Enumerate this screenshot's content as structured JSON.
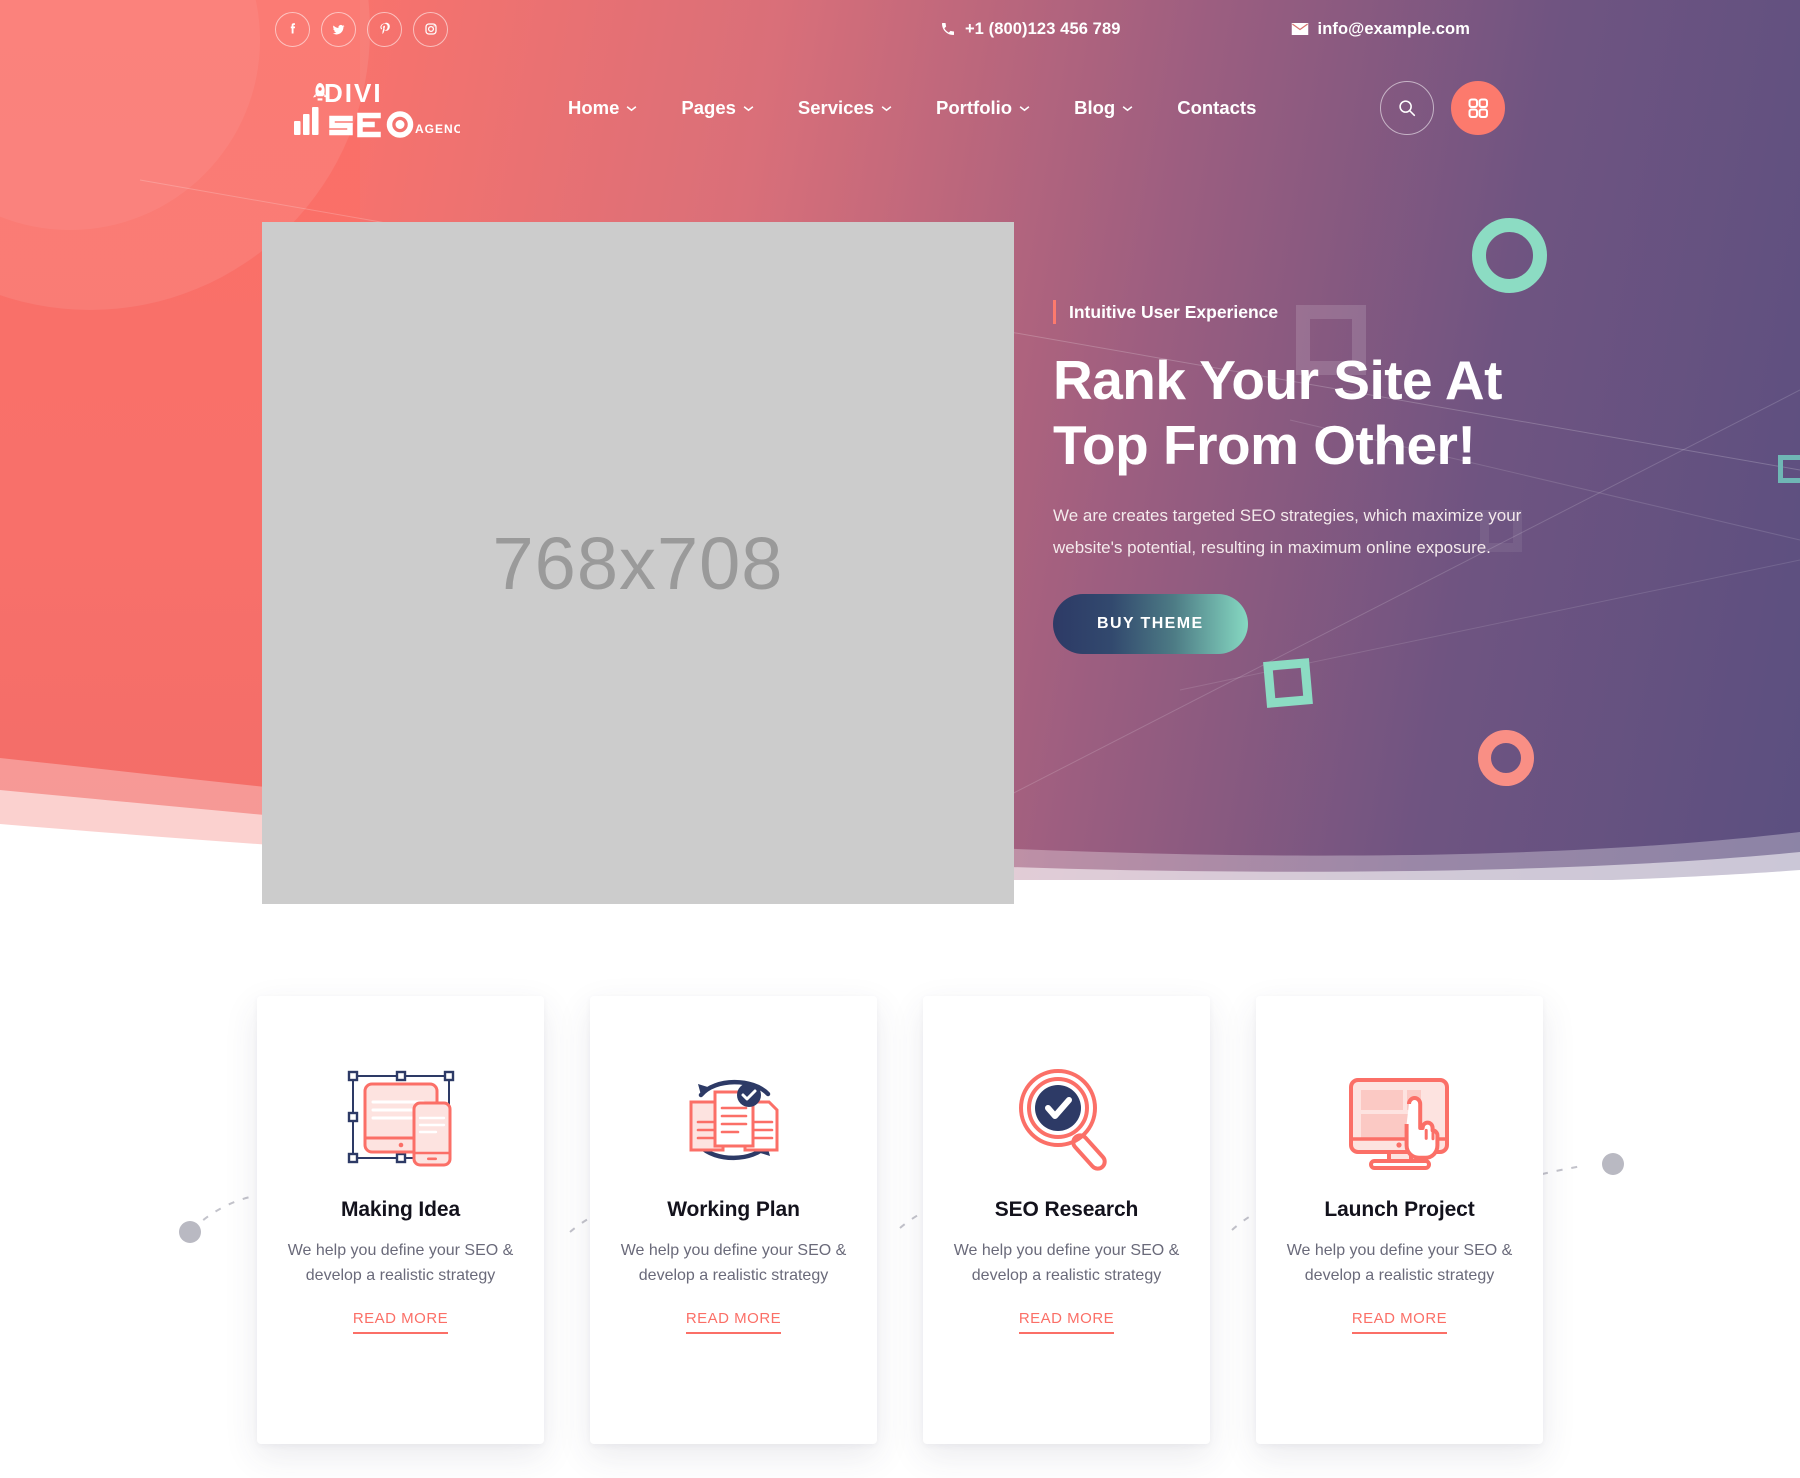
{
  "topbar": {
    "social": [
      {
        "name": "facebook",
        "label": "Facebook"
      },
      {
        "name": "twitter",
        "label": "Twitter"
      },
      {
        "name": "pinterest",
        "label": "Pinterest"
      },
      {
        "name": "instagram",
        "label": "Instagram"
      }
    ],
    "phone": "+1 (800)123 456 789",
    "email": "info@example.com"
  },
  "logo": {
    "line1": "DIVI",
    "line2": "SEO",
    "suffix": "AGENCY"
  },
  "nav": [
    {
      "label": "Home",
      "has_dropdown": true
    },
    {
      "label": "Pages",
      "has_dropdown": true
    },
    {
      "label": "Services",
      "has_dropdown": true
    },
    {
      "label": "Portfolio",
      "has_dropdown": true
    },
    {
      "label": "Blog",
      "has_dropdown": true
    },
    {
      "label": "Contacts",
      "has_dropdown": false
    }
  ],
  "header_actions": {
    "search_label": "Search",
    "grid_label": "Menu grid"
  },
  "hero": {
    "image_placeholder": "768x708",
    "eyebrow": "Intuitive User Experience",
    "title_line1": "Rank Your Site At",
    "title_line2": "Top From Other!",
    "subtitle": "We are creates targeted SEO strategies, which maximize your website's potential, resulting in maximum online exposure.",
    "cta_label": "BUY THEME"
  },
  "cards": [
    {
      "icon": "responsive-devices-icon",
      "title": "Making Idea",
      "text": "We help you define your SEO & develop a realistic strategy",
      "link": "READ MORE"
    },
    {
      "icon": "documents-sync-icon",
      "title": "Working Plan",
      "text": "We help you define your SEO & develop a realistic strategy",
      "link": "READ MORE"
    },
    {
      "icon": "magnifier-check-icon",
      "title": "SEO Research",
      "text": "We help you define your SEO & develop a realistic strategy",
      "link": "READ MORE"
    },
    {
      "icon": "monitor-click-icon",
      "title": "Launch Project",
      "text": "We help you define your SEO & develop a realistic strategy",
      "link": "READ MORE"
    }
  ],
  "colors": {
    "coral": "#fb6f67",
    "coral_accent": "#fc7a6d",
    "navy": "#2d3a66",
    "mint": "#8cdcc3",
    "teal": "#6fb7b5",
    "card_bg": "#ffffff",
    "placeholder_gray": "#cccccc",
    "text_dark": "#13121c",
    "text_muted": "#6a6a7a"
  }
}
